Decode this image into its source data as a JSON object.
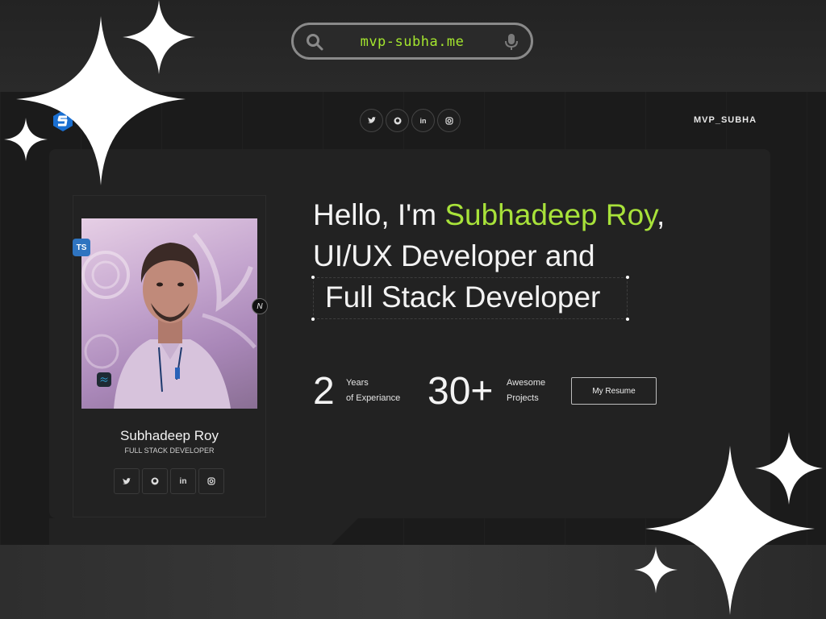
{
  "browser": {
    "url": "mvp-subha.me",
    "search_icon": "search-icon",
    "mic_icon": "microphone-icon"
  },
  "nav": {
    "logo": "s-logo-icon",
    "social": [
      "twitter-icon",
      "github-icon",
      "linkedin-icon",
      "instagram-icon"
    ],
    "brand": "MVP_SUBHA"
  },
  "profile": {
    "name": "Subhadeep Roy",
    "role": "FULL STACK DEVELOPER",
    "badges": {
      "ts": "TS",
      "n": "N"
    },
    "social": [
      "twitter-icon",
      "github-icon",
      "linkedin-icon",
      "instagram-icon"
    ]
  },
  "hero": {
    "line1_prefix": "Hello, I'm ",
    "line1_name": "Subhadeep Roy",
    "line1_suffix": ",",
    "line2": "UI/UX Developer and",
    "line3": "Full Stack Developer"
  },
  "stats": [
    {
      "number": "2",
      "label_top": "Years",
      "label_bottom": "of Experiance"
    },
    {
      "number": "30+",
      "label_top": "Awesome",
      "label_bottom": "Projects"
    }
  ],
  "resume_button": "My Resume",
  "colors": {
    "accent": "#a8e23a",
    "background": "#1b1b1b",
    "panel": "#222222"
  }
}
